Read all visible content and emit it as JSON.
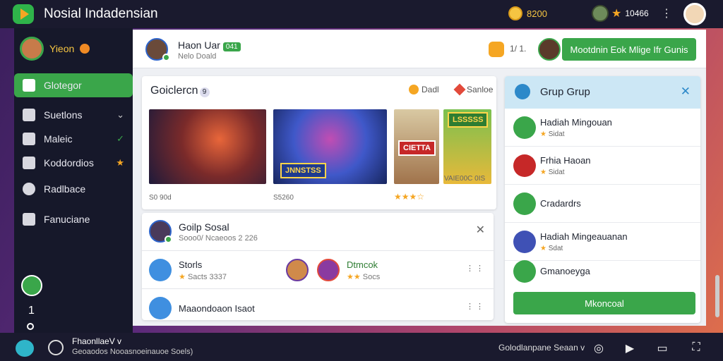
{
  "topbar": {
    "title": "Nosial Indadensian",
    "coins": "8200",
    "level": "10466",
    "menu_glyph": "⋮"
  },
  "sidebar": {
    "username": "Yieon",
    "items": [
      {
        "label": "Glotegor",
        "icon": "grid-icon",
        "active": true
      },
      {
        "label": "Suetlons",
        "icon": "home-icon",
        "trail": "v"
      },
      {
        "label": "Maleic",
        "icon": "pen-icon",
        "trail": "x"
      },
      {
        "label": "Koddordios",
        "icon": "calendar-icon",
        "trail": "★"
      },
      {
        "label": "Radlbace",
        "icon": "gear-icon"
      },
      {
        "label": "Fanuciane",
        "icon": "user-icon"
      }
    ],
    "bottom_num": "1"
  },
  "header": {
    "name": "Haon Uar",
    "tag": "041",
    "sub": "Nelo Doald",
    "count": "1/ 1.",
    "button": "Mootdnin Eok Mlige Ifr Gunis"
  },
  "games": {
    "title": "Goiclercn",
    "count": "9",
    "filter1": "Dadl",
    "filter2": "Sanloe",
    "thumb_labels": [
      "JNNSTSS",
      "CIETTA",
      "LSSSSS"
    ],
    "meta": [
      "S0 90d",
      "S5260",
      "VAIE00C 0IS"
    ],
    "stars": "★★★☆"
  },
  "social": {
    "title": "Goilp Sosal",
    "sub": "Sooo0/ Ncaeoos 2 226",
    "close": "✕",
    "row1": {
      "title": "Storls",
      "stars": "★",
      "sub": "Sacts 3337",
      "friend_title": "Dtmcok",
      "friend_stars": "★★",
      "friend_sub": "Socs",
      "more": "⋮ ⋮"
    },
    "row2": {
      "title": "Maaondoaon Isaot",
      "more": "⋮ ⋮"
    }
  },
  "group": {
    "title": "Grup Grup",
    "close": "✕",
    "items": [
      {
        "name": "Hadiah Mingouan",
        "sub": "Sidat",
        "stars": "★",
        "color": "#3aa64a"
      },
      {
        "name": "Frhia Haoan",
        "sub": "Sidat",
        "stars": "★",
        "color": "#c62828"
      },
      {
        "name": "Cradardrs",
        "sub": "",
        "stars": "",
        "color": "#3aa64a"
      },
      {
        "name": "Hadiah Mingeauanan",
        "sub": "Sdat",
        "stars": "★",
        "color": "#3f51b5"
      },
      {
        "name": "Gmanoeyga",
        "sub": "",
        "stars": "",
        "color": "#3aa64a"
      }
    ],
    "button": "Mkoncoal"
  },
  "bottombar": {
    "title": "FhaonllaeV v",
    "sub": "Geoaodos Nooasnoeinauoe Soels)",
    "lang": "Golodlanpane Seaan v",
    "icons": [
      "gamepad-icon",
      "play-icon",
      "monitor-icon",
      "fullscreen-icon"
    ]
  }
}
